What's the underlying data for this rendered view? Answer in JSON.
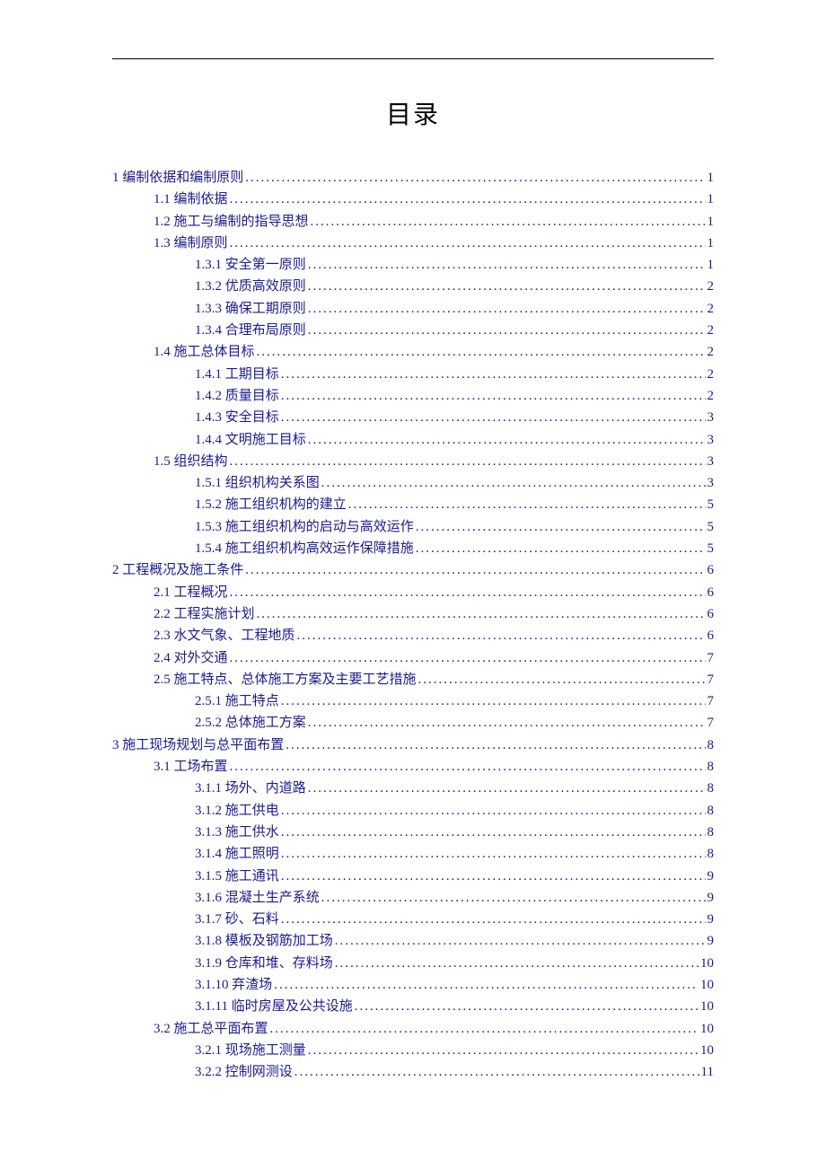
{
  "title": "目录",
  "toc": [
    {
      "level": 1,
      "label": "1 编制依据和编制原则",
      "page": "1"
    },
    {
      "level": 2,
      "label": "1.1 编制依据",
      "page": "1"
    },
    {
      "level": 2,
      "label": "1.2  施工与编制的指导思想",
      "page": "1"
    },
    {
      "level": 2,
      "label": "1.3  编制原则",
      "page": "1"
    },
    {
      "level": 3,
      "label": "1.3.1 安全第一原则",
      "page": "1"
    },
    {
      "level": 3,
      "label": "1.3.2 优质高效原则",
      "page": "2"
    },
    {
      "level": 3,
      "label": "1.3.3 确保工期原则",
      "page": "2"
    },
    {
      "level": 3,
      "label": "1.3.4 合理布局原则",
      "page": "2"
    },
    {
      "level": 2,
      "label": "1.4 施工总体目标",
      "page": "2"
    },
    {
      "level": 3,
      "label": "1.4.1 工期目标",
      "page": "2"
    },
    {
      "level": 3,
      "label": "1.4.2 质量目标",
      "page": "2"
    },
    {
      "level": 3,
      "label": "1.4.3  安全目标",
      "page": "3"
    },
    {
      "level": 3,
      "label": "1.4.4 文明施工目标",
      "page": "3"
    },
    {
      "level": 2,
      "label": "1.5 组织结构",
      "page": "3"
    },
    {
      "level": 3,
      "label": "1.5.1 组织机构关系图",
      "page": "3"
    },
    {
      "level": 3,
      "label": "1.5.2 施工组织机构的建立",
      "page": "5"
    },
    {
      "level": 3,
      "label": "1.5.3 施工组织机构的启动与高效运作",
      "page": "5"
    },
    {
      "level": 3,
      "label": "1.5.4 施工组织机构高效运作保障措施",
      "page": "5"
    },
    {
      "level": 1,
      "label": "2  工程概况及施工条件",
      "page": "6"
    },
    {
      "level": 2,
      "label": "2.1 工程概况",
      "page": "6"
    },
    {
      "level": 2,
      "label": "2.2 工程实施计划",
      "page": "6"
    },
    {
      "level": 2,
      "label": "2.3 水文气象、工程地质",
      "page": "6"
    },
    {
      "level": 2,
      "label": "2.4 对外交通",
      "page": "7"
    },
    {
      "level": 2,
      "label": "2.5 施工特点、总体施工方案及主要工艺措施",
      "page": "7"
    },
    {
      "level": 3,
      "label": "2.5.1 施工特点",
      "page": "7"
    },
    {
      "level": 3,
      "label": "2.5.2 总体施工方案",
      "page": "7"
    },
    {
      "level": 1,
      "label": "3   施工现场规划与总平面布置",
      "page": "8"
    },
    {
      "level": 2,
      "label": "3.1 工场布置",
      "page": "8"
    },
    {
      "level": 3,
      "label": "3.1.1 场外、内道路",
      "page": "8"
    },
    {
      "level": 3,
      "label": "3.1.2 施工供电",
      "page": "8"
    },
    {
      "level": 3,
      "label": "3.1.3 施工供水",
      "page": "8"
    },
    {
      "level": 3,
      "label": "3.1.4  施工照明",
      "page": "8"
    },
    {
      "level": 3,
      "label": "3.1.5 施工通讯",
      "page": "9"
    },
    {
      "level": 3,
      "label": "3.1.6   混凝土生产系统",
      "page": "9"
    },
    {
      "level": 3,
      "label": "3.1.7 砂、石料",
      "page": "9"
    },
    {
      "level": 3,
      "label": "3.1.8 模板及钢筋加工场",
      "page": "9"
    },
    {
      "level": 3,
      "label": "3.1.9 仓库和堆、存料场",
      "page": "10"
    },
    {
      "level": 3,
      "label": "3.1.10 弃渣场",
      "page": "10"
    },
    {
      "level": 3,
      "label": "3.1.11 临时房屋及公共设施",
      "page": "10"
    },
    {
      "level": 2,
      "label": "3.2 施工总平面布置",
      "page": "10"
    },
    {
      "level": 3,
      "label": "3.2.1 现场施工测量",
      "page": "10"
    },
    {
      "level": 3,
      "label": "3.2.2 控制网测设",
      "page": "11"
    }
  ]
}
